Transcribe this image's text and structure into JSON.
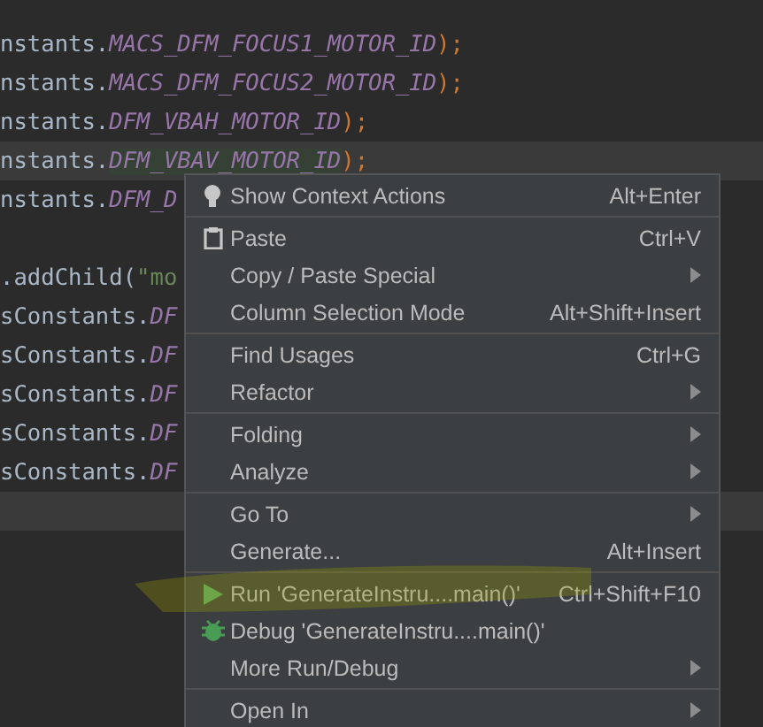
{
  "editor": {
    "lines": [
      {
        "highlighted": false,
        "segments": [
          {
            "kind": "plain",
            "text": "nstants."
          },
          {
            "kind": "constant",
            "text": "MACS_DFM_FOCUS1_MOTOR_ID"
          },
          {
            "kind": "punct",
            "text": ");"
          }
        ]
      },
      {
        "highlighted": false,
        "segments": [
          {
            "kind": "plain",
            "text": "nstants."
          },
          {
            "kind": "constant",
            "text": "MACS_DFM_FOCUS2_MOTOR_ID"
          },
          {
            "kind": "punct",
            "text": ");"
          }
        ]
      },
      {
        "highlighted": false,
        "segments": [
          {
            "kind": "plain",
            "text": "nstants."
          },
          {
            "kind": "constant",
            "text": "DFM_VBAH_MOTOR_ID"
          },
          {
            "kind": "punct",
            "text": ");"
          }
        ]
      },
      {
        "highlighted": true,
        "segments": [
          {
            "kind": "plain",
            "text": "nstants."
          },
          {
            "kind": "usage",
            "text": "DFM_VBAV_MOTOR_ID"
          },
          {
            "kind": "punct",
            "text": ");"
          }
        ]
      },
      {
        "highlighted": false,
        "segments": [
          {
            "kind": "plain",
            "text": "nstants."
          },
          {
            "kind": "constant",
            "text": "DFM_D"
          }
        ]
      },
      {
        "highlighted": false
      },
      {
        "highlighted": false,
        "segments": [
          {
            "kind": "plain",
            "text": ".addChild("
          },
          {
            "kind": "string",
            "text": "\"mo"
          }
        ]
      },
      {
        "highlighted": false,
        "segments": [
          {
            "kind": "plain",
            "text": "sConstants."
          },
          {
            "kind": "constant",
            "text": "DF"
          }
        ]
      },
      {
        "highlighted": false,
        "segments": [
          {
            "kind": "plain",
            "text": "sConstants."
          },
          {
            "kind": "constant",
            "text": "DF"
          }
        ]
      },
      {
        "highlighted": false,
        "segments": [
          {
            "kind": "plain",
            "text": "sConstants."
          },
          {
            "kind": "constant",
            "text": "DF"
          }
        ]
      },
      {
        "highlighted": false,
        "segments": [
          {
            "kind": "plain",
            "text": "sConstants."
          },
          {
            "kind": "constant",
            "text": "DF"
          }
        ]
      },
      {
        "highlighted": false,
        "segments": [
          {
            "kind": "plain",
            "text": "sConstants."
          },
          {
            "kind": "constant",
            "text": "DF"
          }
        ]
      },
      {
        "highlighted": true
      }
    ]
  },
  "context_menu": {
    "groups": [
      [
        {
          "kind": "context-actions",
          "label": "Show Context Actions",
          "shortcut": "Alt+Enter",
          "submenu": false
        }
      ],
      [
        {
          "kind": "paste",
          "label": "Paste",
          "shortcut": "Ctrl+V",
          "submenu": false
        },
        {
          "kind": "plain",
          "label": "Copy / Paste Special",
          "submenu": true
        },
        {
          "kind": "plain",
          "label": "Column Selection Mode",
          "shortcut": "Alt+Shift+Insert",
          "submenu": false
        }
      ],
      [
        {
          "kind": "plain",
          "label": "Find Usages",
          "shortcut": "Ctrl+G",
          "submenu": false
        },
        {
          "kind": "plain",
          "label": "Refactor",
          "submenu": true
        }
      ],
      [
        {
          "kind": "plain",
          "label": "Folding",
          "submenu": true
        },
        {
          "kind": "plain",
          "label": "Analyze",
          "submenu": true
        }
      ],
      [
        {
          "kind": "plain",
          "label": "Go To",
          "submenu": true
        },
        {
          "kind": "plain",
          "label": "Generate...",
          "shortcut": "Alt+Insert",
          "submenu": false
        }
      ],
      [
        {
          "kind": "run",
          "label": "Run 'GenerateInstru....main()'",
          "shortcut": "Ctrl+Shift+F10",
          "submenu": false
        },
        {
          "kind": "debug",
          "label": "Debug 'GenerateInstru....main()'",
          "submenu": false
        },
        {
          "kind": "plain",
          "label": "More Run/Debug",
          "submenu": true
        }
      ],
      [
        {
          "kind": "plain",
          "label": "Open In",
          "submenu": true
        }
      ]
    ]
  }
}
